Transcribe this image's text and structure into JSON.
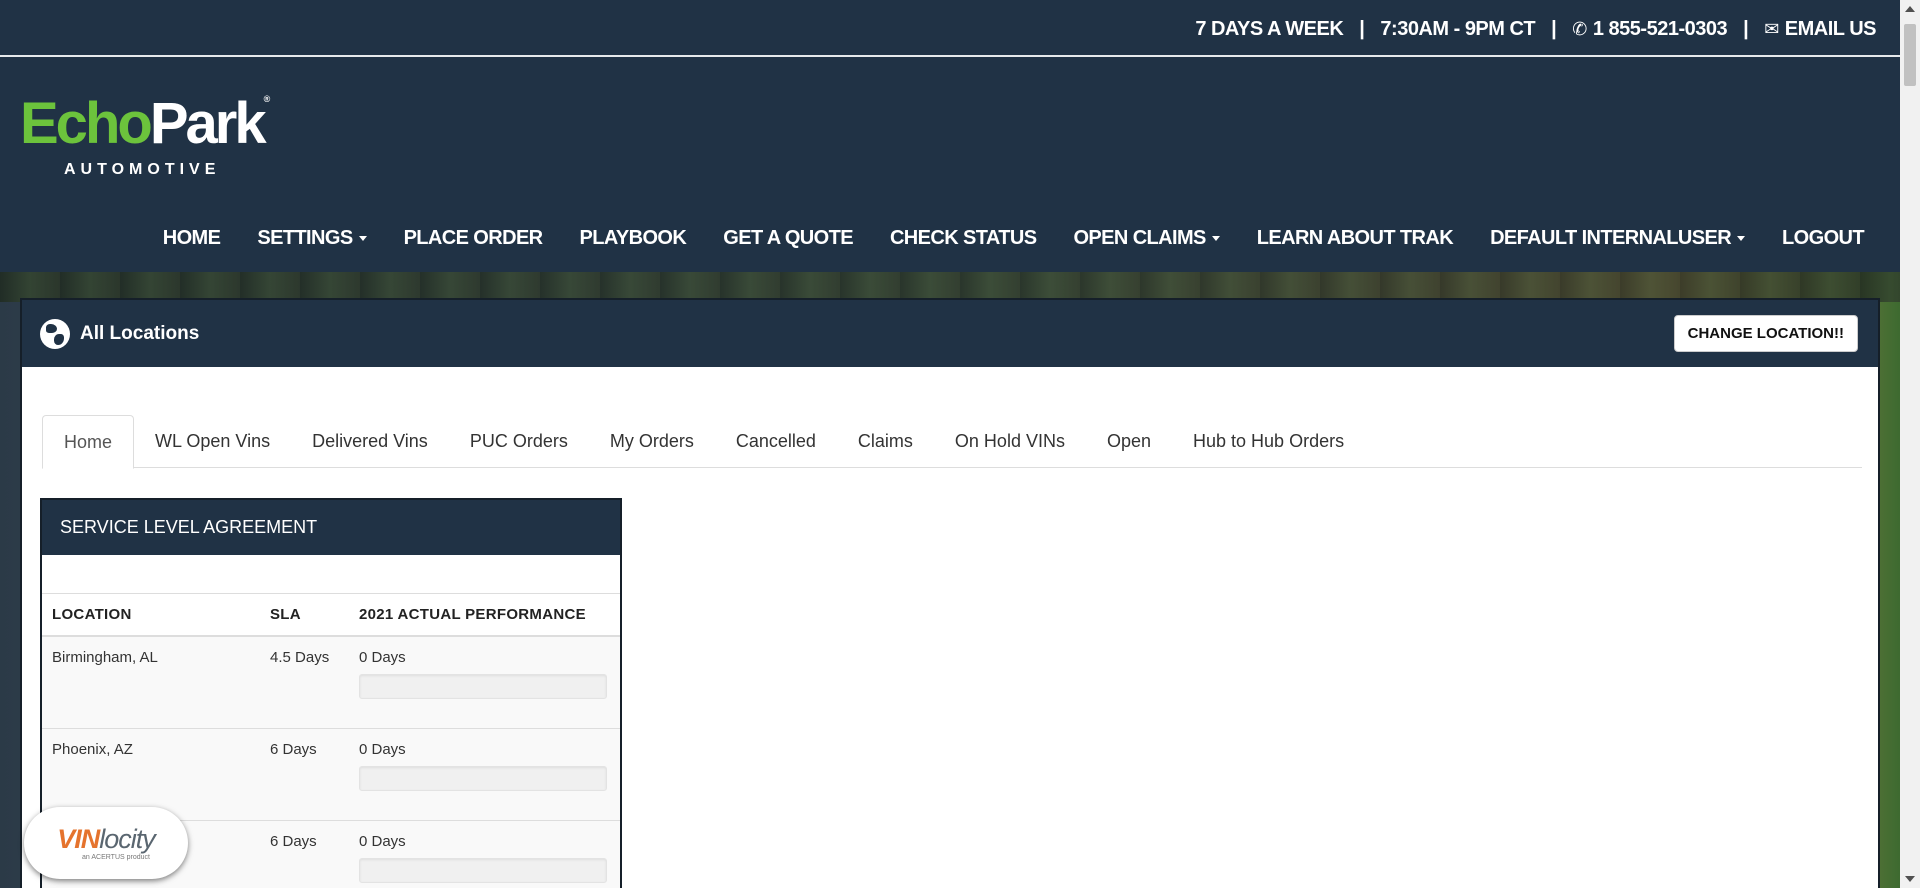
{
  "topbar": {
    "days": "7 DAYS A WEEK",
    "sep": "|",
    "hours": "7:30AM - 9PM CT",
    "phone": "1 855-521-0303",
    "email": "EMAIL US"
  },
  "logo": {
    "echo": "Echo",
    "park": "Park",
    "registered": "®",
    "sub": "AUTOMOTIVE"
  },
  "nav": {
    "items": [
      {
        "label": "HOME"
      },
      {
        "label": "SETTINGS"
      },
      {
        "label": "PLACE ORDER"
      },
      {
        "label": "PLAYBOOK"
      },
      {
        "label": "GET A QUOTE"
      },
      {
        "label": "CHECK STATUS"
      },
      {
        "label": "OPEN CLAIMS"
      },
      {
        "label": "LEARN ABOUT TRAK"
      },
      {
        "label": "DEFAULT INTERNALUSER"
      },
      {
        "label": "LOGOUT"
      }
    ]
  },
  "panel": {
    "title": "All Locations",
    "change_location": "CHANGE LOCATION!!"
  },
  "tabs": [
    {
      "label": "Home",
      "active": true
    },
    {
      "label": "WL Open Vins"
    },
    {
      "label": "Delivered Vins"
    },
    {
      "label": "PUC Orders"
    },
    {
      "label": "My Orders"
    },
    {
      "label": "Cancelled"
    },
    {
      "label": "Claims"
    },
    {
      "label": "On Hold VINs"
    },
    {
      "label": "Open"
    },
    {
      "label": "Hub to Hub Orders"
    }
  ],
  "sla": {
    "title": "SERVICE LEVEL AGREEMENT",
    "columns": [
      "LOCATION",
      "SLA",
      "2021 ACTUAL PERFORMANCE"
    ],
    "rows": [
      {
        "location": "Birmingham, AL",
        "sla": "4.5 Days",
        "actual": "0 Days",
        "progress": 0
      },
      {
        "location": "Phoenix, AZ",
        "sla": "6 Days",
        "actual": "0 Days",
        "progress": 0
      },
      {
        "location": "",
        "sla": "6 Days",
        "actual": "0 Days",
        "progress": 0
      }
    ]
  },
  "badge": {
    "vin": "VIN",
    "locity": "locity",
    "sub": "an ACERTUS product"
  },
  "colors": {
    "header_bg": "#203245",
    "logo_green": "#6cc33c",
    "vin_orange": "#e5732d"
  }
}
